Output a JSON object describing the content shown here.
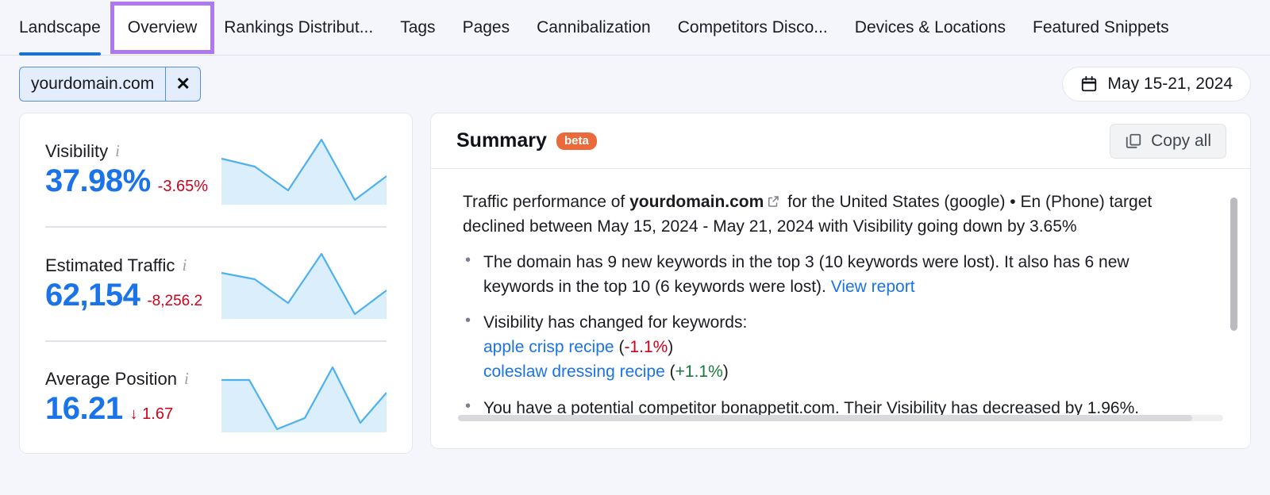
{
  "tabs": [
    {
      "label": "Landscape",
      "active": true,
      "highlighted": false
    },
    {
      "label": "Overview",
      "active": false,
      "highlighted": true
    },
    {
      "label": "Rankings Distribut...",
      "active": false,
      "highlighted": false
    },
    {
      "label": "Tags",
      "active": false,
      "highlighted": false
    },
    {
      "label": "Pages",
      "active": false,
      "highlighted": false
    },
    {
      "label": "Cannibalization",
      "active": false,
      "highlighted": false
    },
    {
      "label": "Competitors Disco...",
      "active": false,
      "highlighted": false
    },
    {
      "label": "Devices & Locations",
      "active": false,
      "highlighted": false
    },
    {
      "label": "Featured Snippets",
      "active": false,
      "highlighted": false
    }
  ],
  "filter": {
    "domain_chip": "yourdomain.com",
    "remove_icon": "close-icon",
    "date_range": "May 15-21, 2024",
    "calendar_icon": "calendar-icon"
  },
  "metrics": [
    {
      "title": "Visibility",
      "value": "37.98%",
      "delta": "-3.65%",
      "info_icon": "info-icon",
      "sparkline_name": "visibility-sparkline"
    },
    {
      "title": "Estimated Traffic",
      "value": "62,154",
      "delta": "-8,256.2",
      "info_icon": "info-icon",
      "sparkline_name": "estimated-traffic-sparkline"
    },
    {
      "title": "Average Position",
      "value": "16.21",
      "delta": "↓ 1.67",
      "info_icon": "info-icon",
      "sparkline_name": "average-position-sparkline"
    }
  ],
  "summary": {
    "title": "Summary",
    "badge": "beta",
    "copy_label": "Copy all",
    "copy_icon": "copy-icon",
    "intro": {
      "before": "Traffic performance of ",
      "domain": "yourdomain.com",
      "external_icon": "external-link-icon",
      "after": " for the United States (google) • En (Phone) target declined between May 15, 2024 - May 21, 2024 with Visibility going down by 3.65%"
    },
    "bullets": [
      {
        "text": "The domain has 9 new keywords in the top 3 (10 keywords were lost). It also has 6 new keywords in the top 10 (6 keywords were lost). ",
        "link": "View report"
      },
      {
        "text": "Visibility has changed for keywords:",
        "keywords": [
          {
            "name": "apple crisp recipe",
            "change": "-1.1%",
            "direction": "negative"
          },
          {
            "name": "coleslaw dressing recipe",
            "change": "+1.1%",
            "direction": "positive"
          }
        ]
      },
      {
        "text": "You have a potential competitor bonappetit.com. Their Visibility has decreased by 1.96%."
      }
    ]
  },
  "colors": {
    "accent_blue": "#1a73e8",
    "tab_underline": "#1a73cf",
    "highlight_purple": "#ad78f0",
    "negative_red": "#d0021b",
    "positive_green": "#1a7a3c",
    "beta_orange": "#ea6a3c",
    "spark_line": "#4db1f0",
    "spark_fill": "#daeefc"
  },
  "chart_data": [
    {
      "type": "area",
      "name": "visibility-sparkline",
      "title": "Visibility",
      "x": [
        0,
        1,
        2,
        3,
        4,
        5
      ],
      "values": [
        62,
        47,
        32,
        96,
        8,
        44
      ],
      "ylim": [
        0,
        100
      ],
      "grid": false,
      "legend": "none"
    },
    {
      "type": "area",
      "name": "estimated-traffic-sparkline",
      "title": "Estimated Traffic",
      "x": [
        0,
        1,
        2,
        3,
        4,
        5
      ],
      "values": [
        62,
        50,
        33,
        96,
        8,
        44
      ],
      "ylim": [
        0,
        100
      ],
      "grid": false,
      "legend": "none"
    },
    {
      "type": "area",
      "name": "average-position-sparkline",
      "title": "Average Position",
      "x": [
        0,
        1,
        2,
        3,
        4,
        5
      ],
      "values": [
        70,
        70,
        4,
        22,
        96,
        18,
        58
      ],
      "ylim": [
        0,
        100
      ],
      "grid": false,
      "legend": "none"
    }
  ]
}
